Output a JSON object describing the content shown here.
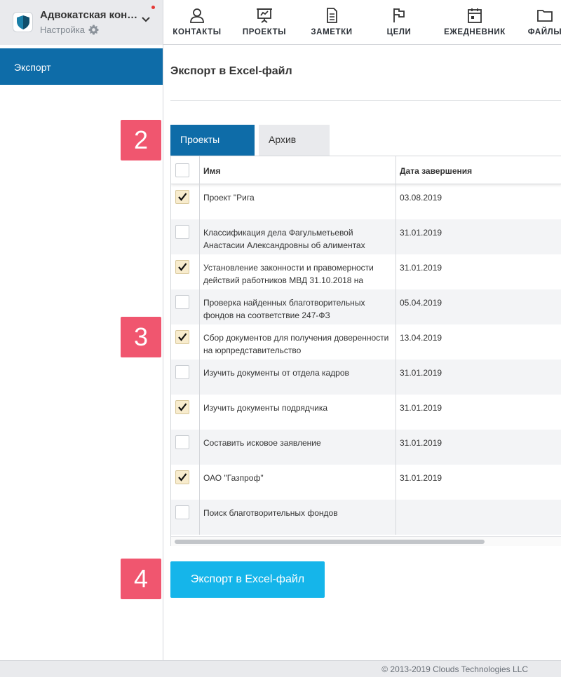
{
  "org": {
    "name": "Адвокатская кон…",
    "subtitle": "Настройка"
  },
  "nav": [
    {
      "label": "КОНТАКТЫ",
      "icon": "person-icon"
    },
    {
      "label": "ПРОЕКТЫ",
      "icon": "presentation-board-icon"
    },
    {
      "label": "ЗАМЕТКИ",
      "icon": "document-icon"
    },
    {
      "label": "ЦЕЛИ",
      "icon": "flag-icon"
    },
    {
      "label": "ЕЖЕДНЕВНИК",
      "icon": "calendar-icon"
    },
    {
      "label": "ФАЙЛЫ",
      "icon": "folder-icon"
    }
  ],
  "sidebar": {
    "items": [
      {
        "label": "Экспорт",
        "active": true
      }
    ]
  },
  "main": {
    "title": "Экспорт в Excel-файл",
    "tabs": [
      {
        "label": "Проекты",
        "active": true
      },
      {
        "label": "Архив",
        "active": false
      }
    ],
    "table": {
      "headers": {
        "name": "Имя",
        "date": "Дата завершения"
      },
      "rows": [
        {
          "name": "Проект \"Рига",
          "date": "03.08.2019",
          "checked": true
        },
        {
          "name": "Классификация дела Фагульметьевой Анастасии Александровны об алиментах",
          "date": "31.01.2019",
          "checked": false
        },
        {
          "name": "Установление законности и правомерности действий работников МВД 31.10.2018 на",
          "date": "31.01.2019",
          "checked": true
        },
        {
          "name": "Проверка найденных благотворительных фондов на соответствие 247-ФЗ",
          "date": "05.04.2019",
          "checked": false
        },
        {
          "name": "Сбор документов для получения доверенности на юрпредставительство",
          "date": "13.04.2019",
          "checked": true
        },
        {
          "name": "Изучить документы от отдела кадров",
          "date": "31.01.2019",
          "checked": false
        },
        {
          "name": "Изучить документы подрядчика",
          "date": "31.01.2019",
          "checked": true
        },
        {
          "name": "Составить исковое заявление",
          "date": "31.01.2019",
          "checked": false
        },
        {
          "name": "ОАО \"Газпроф\"",
          "date": "31.01.2019",
          "checked": true
        },
        {
          "name": "Поиск благотворительных фондов",
          "date": "",
          "checked": false
        }
      ]
    },
    "export_button": "Экспорт в Excel-файл"
  },
  "steps": [
    "2",
    "3",
    "4"
  ],
  "footer": "© 2013-2019 Clouds Technologies LLC",
  "colors": {
    "primary": "#0e6ca8",
    "export_button": "#15b5ea",
    "step_marker": "#f0566f",
    "checked_box": "#f8eccd"
  }
}
